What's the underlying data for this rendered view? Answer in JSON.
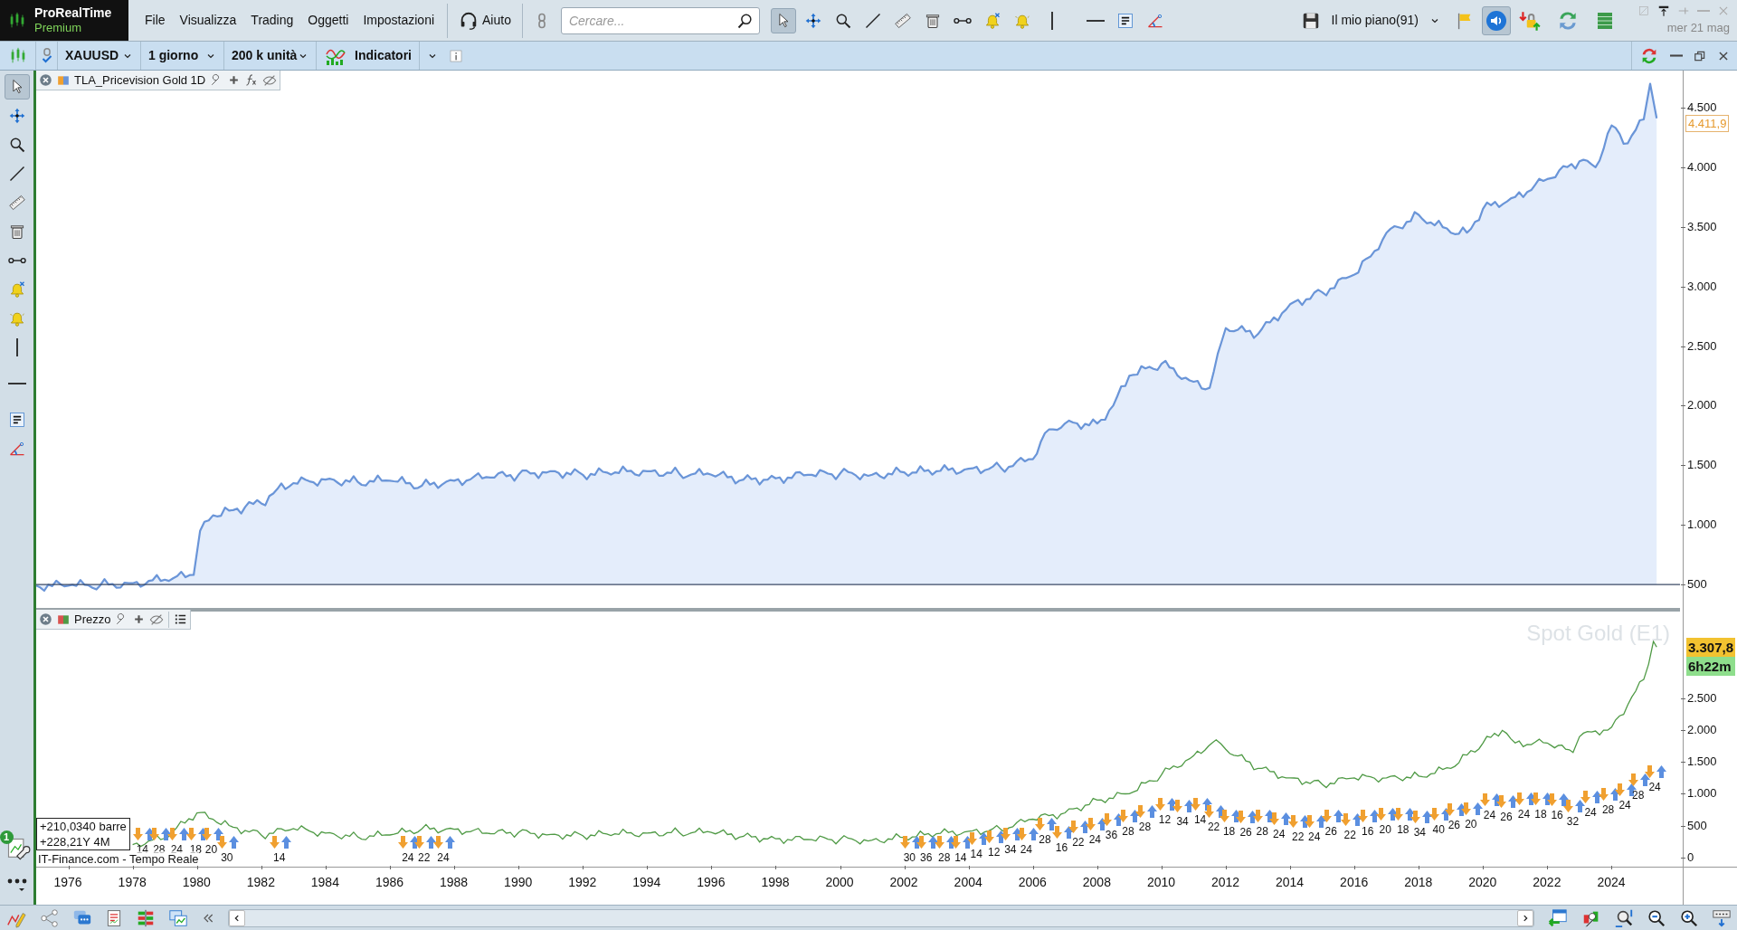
{
  "app": {
    "name": "ProRealTime",
    "edition": "Premium"
  },
  "menu": [
    "File",
    "Visualizza",
    "Trading",
    "Oggetti",
    "Impostazioni"
  ],
  "help": "Aiuto",
  "search": {
    "placeholder": "Cercare..."
  },
  "top_tools": [
    {
      "kind": "pointer",
      "selected": true
    },
    {
      "kind": "move",
      "selected": false
    },
    {
      "kind": "zoom",
      "selected": false
    },
    {
      "kind": "line",
      "selected": false
    },
    {
      "kind": "ruler",
      "selected": false
    },
    {
      "kind": "trash",
      "selected": false
    },
    {
      "kind": "connector",
      "selected": false
    },
    {
      "kind": "bell_cross",
      "selected": false
    },
    {
      "kind": "bell",
      "selected": false
    },
    {
      "kind": "vline",
      "selected": false
    },
    {
      "kind": "hline",
      "selected": false
    },
    {
      "kind": "text",
      "selected": false
    },
    {
      "kind": "angle",
      "selected": false
    }
  ],
  "workspace": "Il mio piano(91)",
  "sound": {
    "on": true
  },
  "date": "mer 21 mag",
  "chart_toolbar": {
    "symbol": "XAUUSD",
    "period": "1 giorno",
    "units": "200 k unità",
    "indicators": "Indicatori"
  },
  "side_tools": [
    {
      "kind": "pointer",
      "selected": true
    },
    {
      "kind": "move",
      "selected": false
    },
    {
      "kind": "zoom",
      "selected": false
    },
    {
      "kind": "line",
      "selected": false
    },
    {
      "kind": "ruler",
      "selected": false
    },
    {
      "kind": "trash",
      "selected": false
    },
    {
      "kind": "connector",
      "selected": false
    },
    {
      "kind": "bell_cross",
      "selected": false
    },
    {
      "kind": "bell",
      "selected": false
    },
    {
      "kind": "vline",
      "selected": false
    },
    {
      "kind": "hline",
      "selected": false
    },
    {
      "kind": "text",
      "selected": false
    },
    {
      "kind": "angle",
      "selected": false
    }
  ],
  "upper_panel": {
    "last_value": "4.411,9",
    "chart_data": {
      "type": "area",
      "xlim": [
        1975,
        2027.9
      ],
      "ylim": [
        288,
        4810
      ],
      "ref_lines": [
        {
          "axis": "y",
          "value": 500
        }
      ],
      "yticks": [
        {
          "value": 500,
          "label": "500"
        },
        {
          "value": 1000,
          "label": "1.000"
        },
        {
          "value": 1500,
          "label": "1.500"
        },
        {
          "value": 2000,
          "label": "2.000"
        },
        {
          "value": 2500,
          "label": "2.500"
        },
        {
          "value": 3000,
          "label": "3.000"
        },
        {
          "value": 3500,
          "label": "3.500"
        },
        {
          "value": 4000,
          "label": "4.000"
        },
        {
          "value": 4500,
          "label": "4.500"
        }
      ],
      "x": [
        1975,
        1976,
        1977,
        1978,
        1979,
        1979.9,
        1980.1,
        1980.5,
        1981,
        1981.5,
        1982,
        1982.5,
        1983,
        1984,
        1985,
        1986,
        1987,
        1988,
        1989,
        1990,
        1991,
        1992,
        1993,
        1994,
        1995,
        1996,
        1997,
        1998,
        1999,
        2000,
        2001,
        2002,
        2003,
        2004,
        2005,
        2006,
        2006.5,
        2007,
        2008,
        2008.5,
        2009,
        2010,
        2011,
        2011.5,
        2012,
        2013,
        2014,
        2015,
        2016,
        2016.5,
        2017,
        2018,
        2019,
        2019.5,
        2020,
        2021,
        2022,
        2023,
        2023.5,
        2024,
        2024.5,
        2025,
        2025.2,
        2025.4
      ],
      "series": [
        {
          "name": "TLA_Pricevision Gold 1D",
          "color": "#6a95d8",
          "values": [
            490,
            490,
            495,
            510,
            540,
            580,
            950,
            1080,
            1120,
            1150,
            1180,
            1300,
            1350,
            1380,
            1360,
            1370,
            1330,
            1370,
            1400,
            1420,
            1450,
            1420,
            1440,
            1450,
            1430,
            1420,
            1380,
            1390,
            1420,
            1430,
            1420,
            1440,
            1450,
            1470,
            1480,
            1550,
            1800,
            1850,
            1850,
            2000,
            2250,
            2350,
            2200,
            2150,
            2650,
            2600,
            2850,
            2950,
            3100,
            3250,
            3450,
            3600,
            3450,
            3450,
            3650,
            3750,
            3900,
            4050,
            4000,
            4350,
            4200,
            4400,
            4700,
            4410
          ]
        }
      ]
    }
  },
  "lower_panel": {
    "watermark": "Spot Gold (E1)",
    "last_price": "3.307,8",
    "countdown": "6h22m",
    "chart_data": {
      "type": "line",
      "xlim": [
        1975,
        2027.9
      ],
      "ylim": [
        -704,
        3899
      ],
      "yticks": [
        {
          "value": 0,
          "label": "0"
        },
        {
          "value": 500,
          "label": "500"
        },
        {
          "value": 1000,
          "label": "1.000"
        },
        {
          "value": 1500,
          "label": "1.500"
        },
        {
          "value": 2000,
          "label": "2.000"
        },
        {
          "value": 2500,
          "label": "2.500"
        }
      ],
      "xticks": [
        1976,
        1978,
        1980,
        1982,
        1984,
        1986,
        1988,
        1990,
        1992,
        1994,
        1996,
        1998,
        2000,
        2002,
        2004,
        2006,
        2008,
        2010,
        2012,
        2014,
        2016,
        2018,
        2020,
        2022,
        2024
      ],
      "x": [
        1978,
        1979,
        1980,
        1980.5,
        1981,
        1982,
        1983,
        1984,
        1985,
        1986,
        1987,
        1988,
        1989,
        1990,
        1991,
        1992,
        1993,
        1994,
        1995,
        1996,
        1997,
        1998,
        1999,
        2000,
        2001,
        2002,
        2003,
        2004,
        2005,
        2006,
        2007,
        2008,
        2009,
        2010,
        2011,
        2011.7,
        2012,
        2013,
        2014,
        2015,
        2016,
        2017,
        2018,
        2019,
        2020,
        2020.6,
        2021,
        2022,
        2022.8,
        2023,
        2024,
        2024.5,
        2025,
        2025.3,
        2025.4
      ],
      "series": [
        {
          "name": "Prezzo",
          "color": "#4f9a45",
          "values": [
            200,
            300,
            700,
            600,
            500,
            350,
            450,
            380,
            320,
            350,
            450,
            440,
            380,
            390,
            360,
            340,
            370,
            380,
            390,
            390,
            330,
            290,
            280,
            280,
            270,
            310,
            370,
            410,
            440,
            600,
            700,
            900,
            1000,
            1300,
            1600,
            1850,
            1700,
            1400,
            1250,
            1150,
            1250,
            1250,
            1280,
            1400,
            1800,
            2000,
            1800,
            1800,
            1650,
            1900,
            2050,
            2400,
            2800,
            3400,
            3310
          ]
        }
      ]
    },
    "signal_labels": [
      "14",
      "28",
      "24",
      "18",
      "20",
      "30",
      "14",
      "24",
      "22",
      "24",
      "30",
      "36",
      "28",
      "14",
      "14",
      "12",
      "34",
      "24",
      "28",
      "16",
      "22",
      "24",
      "36",
      "28",
      "28",
      "12",
      "34",
      "14",
      "22",
      "18",
      "26",
      "28",
      "24",
      "22",
      "24",
      "26",
      "22",
      "16",
      "20",
      "18",
      "34",
      "40",
      "26",
      "20",
      "24",
      "26",
      "24",
      "18",
      "16",
      "32",
      "24",
      "28",
      "24",
      "28",
      "24"
    ]
  },
  "measure": [
    "+210,0340 barre",
    "+228,21Y 4M"
  ],
  "source": "IT-Finance.com - Tempo Reale",
  "alerts_badge": "1"
}
